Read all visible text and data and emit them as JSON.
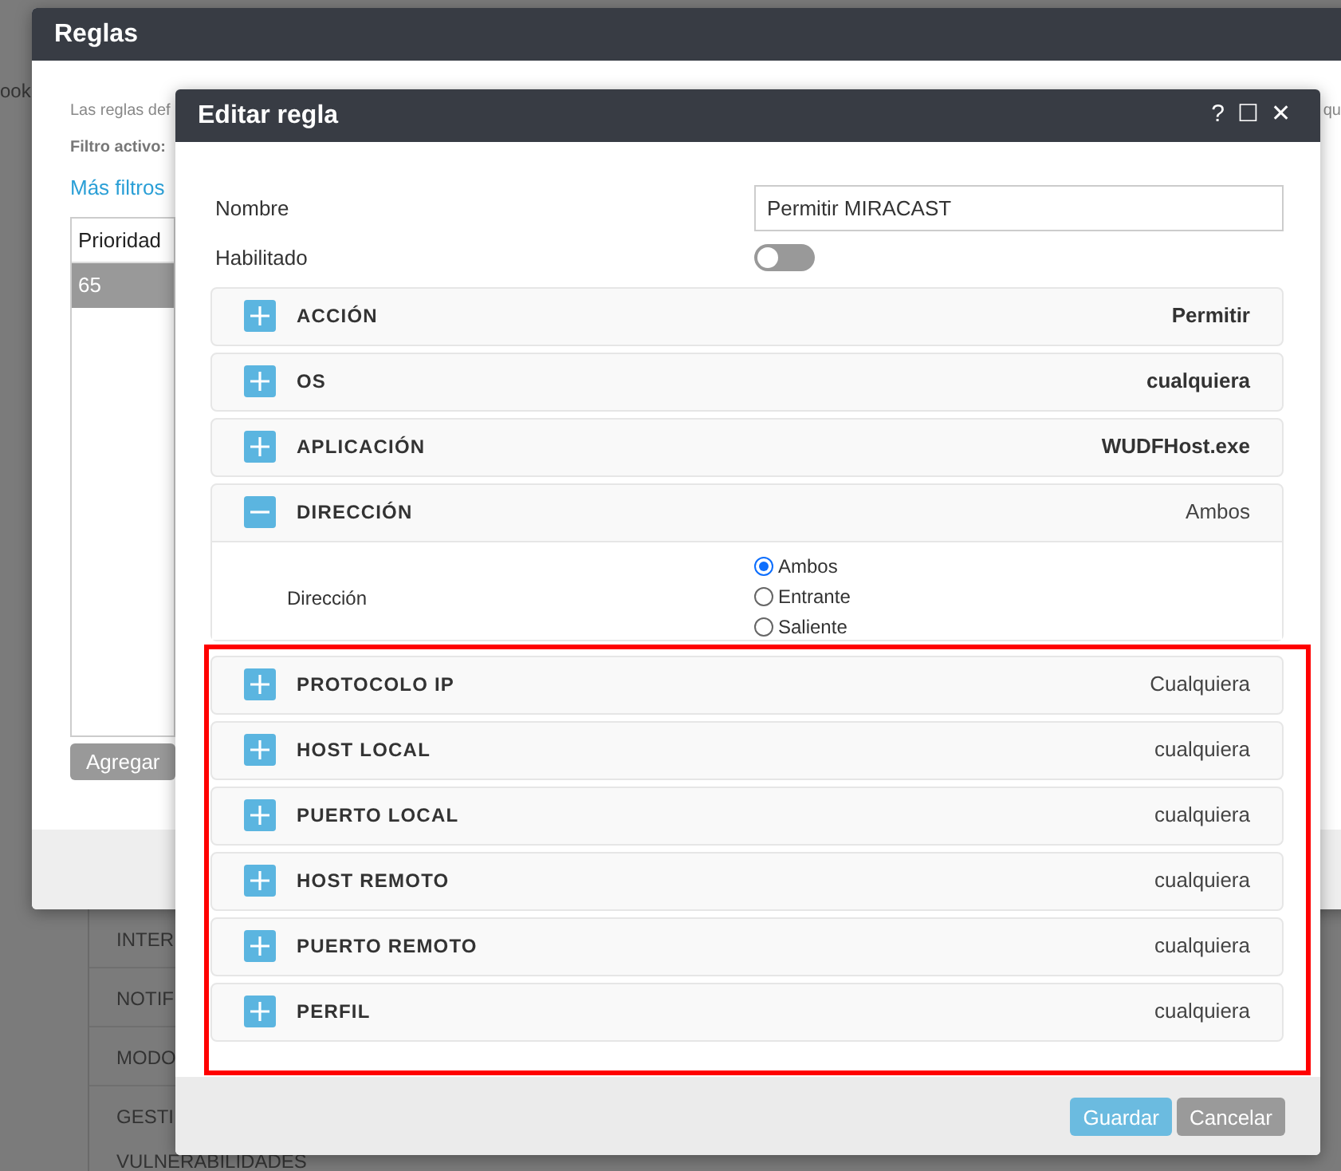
{
  "background": {
    "page_tab": "ook",
    "menu_items": [
      "INTER",
      "NOTIF",
      "MODO",
      "GESTI",
      "VULNERABILIDADES"
    ]
  },
  "rules_dialog": {
    "title": "Reglas",
    "description": "Las reglas def",
    "description_tail": "qu",
    "active_filter_label": "Filtro activo:",
    "more_filters": "Más filtros",
    "table": {
      "columns": [
        "Prioridad"
      ],
      "rows": [
        {
          "cells": [
            "65"
          ],
          "selected": true
        }
      ]
    },
    "add_button": "Agregar"
  },
  "edit_dialog": {
    "title": "Editar regla",
    "controls": [
      "?",
      "☐",
      "✕"
    ],
    "name_label": "Nombre",
    "name_value": "Permitir MIRACAST",
    "enabled_label": "Habilitado",
    "enabled": false,
    "sections": [
      {
        "kind": "collapsed",
        "title": "ACCIÓN",
        "value": "Permitir",
        "value_bold": true
      },
      {
        "kind": "collapsed",
        "title": "OS",
        "value": "cualquiera",
        "value_bold": true
      },
      {
        "kind": "collapsed",
        "title": "APLICACIÓN",
        "value": "WUDFHost.exe",
        "value_bold": true
      },
      {
        "kind": "expanded",
        "title": "DIRECCIÓN",
        "value": "Ambos",
        "value_bold": false,
        "field_label": "Dirección",
        "options": [
          {
            "label": "Ambos",
            "selected": true
          },
          {
            "label": "Entrante",
            "selected": false
          },
          {
            "label": "Saliente",
            "selected": false
          }
        ]
      },
      {
        "kind": "collapsed",
        "title": "PROTOCOLO IP",
        "value": "Cualquiera",
        "value_bold": false
      },
      {
        "kind": "collapsed",
        "title": "HOST LOCAL",
        "value": "cualquiera",
        "value_bold": false
      },
      {
        "kind": "collapsed",
        "title": "PUERTO LOCAL",
        "value": "cualquiera",
        "value_bold": false
      },
      {
        "kind": "collapsed",
        "title": "HOST REMOTO",
        "value": "cualquiera",
        "value_bold": false
      },
      {
        "kind": "collapsed",
        "title": "PUERTO REMOTO",
        "value": "cualquiera",
        "value_bold": false
      },
      {
        "kind": "collapsed",
        "title": "PERFIL",
        "value": "cualquiera",
        "value_bold": false
      }
    ],
    "buttons": [
      {
        "label": "Guardar",
        "kind": "primary"
      },
      {
        "label": "Cancelar",
        "kind": "secondary"
      }
    ]
  }
}
